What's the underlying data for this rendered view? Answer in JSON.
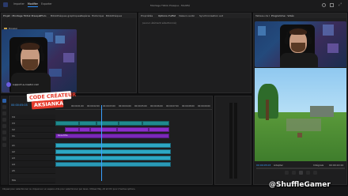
{
  "menubar": {
    "tabs": [
      {
        "label": "Importer"
      },
      {
        "label": "Modifier"
      },
      {
        "label": "Exporter"
      }
    ],
    "window_title": "Montage Tiktok Presque - Modifié"
  },
  "source_panel": {
    "tabs": [
      "Projet : Montage Tiktok Presque",
      "Effets",
      "Bibliothèques graphiques",
      "Repères",
      "Historique",
      "Bibliothèques"
    ],
    "items": [
      {
        "label": "Dossier"
      },
      {
        "label": "Extraits / séquences"
      }
    ]
  },
  "effects_panel": {
    "tabs": [
      "Propriétés",
      "Options d'effet",
      "Valeurs audio",
      "Boîte de mixage audio",
      "Synchronisation automatique de l'audio"
    ],
    "subtitle": "(aucun élément sélectionné)"
  },
  "program_monitor": {
    "tabs": [
      "Tableau de bord de l'audio",
      "Programme : Vidéo"
    ],
    "sequence_label": "Nom : Vidéo Montée",
    "timecode_left": "00:00:05:03",
    "timecode_right": "00:00:22:24",
    "fit_label": "Adapter",
    "quality_label": "Intégrale"
  },
  "overlay": {
    "line1": "CODE CRÉATEUR",
    "line2": "AKSIANKA",
    "watermark": "@ShuffleGamer",
    "webcam_tag": "support-a-creator.com"
  },
  "timeline": {
    "timecode": "00:00:05:03",
    "ruler_labels": [
      "00:00",
      "00:00:01:00",
      "00:00:02:00",
      "00:00:03:00",
      "00:00:04:00",
      "00:00:05:00",
      "00:00:06:00",
      "00:00:07:00",
      "00:00:08:00",
      "00:00:09:00"
    ],
    "tracks": [
      {
        "name": "V4"
      },
      {
        "name": "V3"
      },
      {
        "name": "V2"
      },
      {
        "name": "V1"
      },
      {
        "name": "A1"
      },
      {
        "name": "A2"
      },
      {
        "name": "A3"
      },
      {
        "name": "A4"
      },
      {
        "name": "A5"
      },
      {
        "name": "Mix"
      }
    ],
    "subtitle_clip": "Sous-titre"
  },
  "statusbar": {
    "text": "Cliquez pour sélectionner ou cliquez sur un espace vide pour sélectionner par lasso. Utilisez Maj, Alt et Ctrl pour d'autres options."
  },
  "colors": {
    "accent": "#2b8cf6",
    "teal_clip": "#1f8a8e",
    "purple_clip": "#8a2ec9",
    "audio_clip": "#2da8c4",
    "overlay_red": "#e63a2c",
    "playhead": "#3aa0ff"
  }
}
